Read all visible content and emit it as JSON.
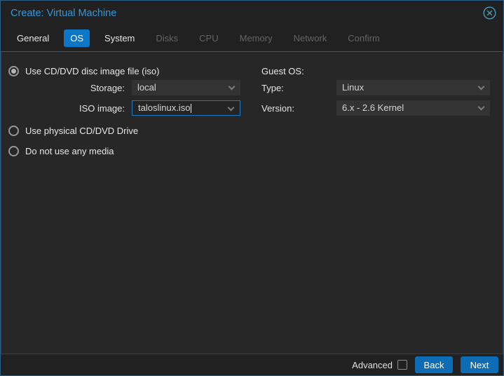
{
  "window": {
    "title": "Create: Virtual Machine"
  },
  "tabs": [
    {
      "label": "General",
      "state": "enabled"
    },
    {
      "label": "OS",
      "state": "active"
    },
    {
      "label": "System",
      "state": "enabled"
    },
    {
      "label": "Disks",
      "state": "disabled"
    },
    {
      "label": "CPU",
      "state": "disabled"
    },
    {
      "label": "Memory",
      "state": "disabled"
    },
    {
      "label": "Network",
      "state": "disabled"
    },
    {
      "label": "Confirm",
      "state": "disabled"
    }
  ],
  "media_options": {
    "use_iso": {
      "label": "Use CD/DVD disc image file (iso)",
      "selected": true
    },
    "use_physical": {
      "label": "Use physical CD/DVD Drive",
      "selected": false
    },
    "no_media": {
      "label": "Do not use any media",
      "selected": false
    }
  },
  "fields": {
    "storage": {
      "label": "Storage:",
      "value": "local"
    },
    "iso_image": {
      "label": "ISO image:",
      "value": "taloslinux.iso",
      "focused": true
    }
  },
  "guest_os": {
    "heading": "Guest OS:",
    "type": {
      "label": "Type:",
      "value": "Linux"
    },
    "version": {
      "label": "Version:",
      "value": "6.x - 2.6 Kernel"
    }
  },
  "footer": {
    "advanced_label": "Advanced",
    "advanced_checked": false,
    "back_label": "Back",
    "next_label": "Next"
  },
  "icons": {
    "close": "circle-x",
    "dropdown": "chevron-down"
  },
  "colors": {
    "title_blue": "#3398da",
    "active_tab_blue": "#0d76c6",
    "button_blue": "#0e6cb4",
    "focus_border_blue": "#2178bd",
    "content_bg": "#272727",
    "chrome_bg": "#212121"
  }
}
